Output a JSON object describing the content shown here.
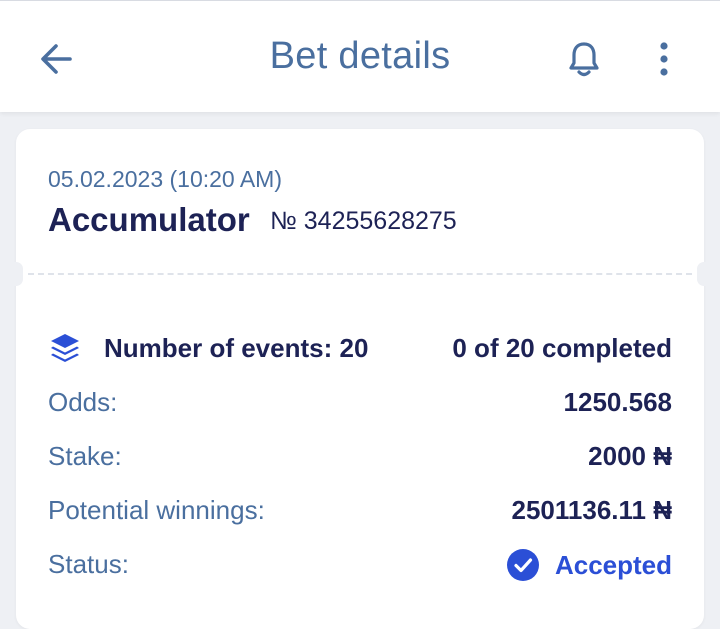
{
  "header": {
    "title": "Bet details",
    "back_icon": "arrow-left-icon",
    "bell_icon": "bell-icon",
    "more_icon": "more-vertical-icon"
  },
  "bet": {
    "date": "05.02.2023 (10:20 AM)",
    "type": "Accumulator",
    "number": "№ 34255628275"
  },
  "events": {
    "label": "Number of events: 20",
    "completed": "0 of 20 completed",
    "icon": "layers-icon"
  },
  "details": {
    "odds_label": "Odds:",
    "odds_value": "1250.568",
    "stake_label": "Stake:",
    "stake_value": "2000 ₦",
    "winnings_label": "Potential winnings:",
    "winnings_value": "2501136.11 ₦",
    "status_label": "Status:",
    "status_value": "Accepted",
    "status_icon": "check-circle-icon"
  },
  "colors": {
    "accent": "#4a6f9f",
    "text_dark": "#1d2255",
    "status_accepted": "#2b4fd6",
    "background": "#eef0f4"
  }
}
